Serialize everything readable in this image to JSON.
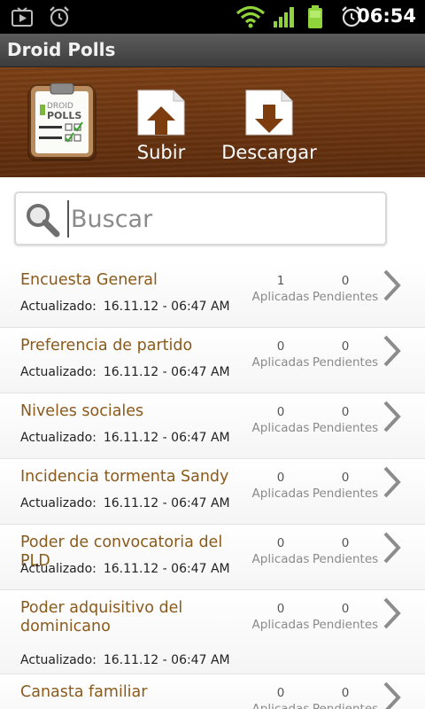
{
  "status_bar": {
    "time": "06:54",
    "icons": [
      "play-store-icon",
      "alarm-icon",
      "wifi-icon",
      "signal-icon",
      "battery-icon",
      "alarm-clock-icon"
    ]
  },
  "app_title": "Droid Polls",
  "toolbar": {
    "logo_text_top": "DROID",
    "logo_text_bottom": "POLLS",
    "upload_label": "Subir",
    "download_label": "Descargar"
  },
  "search": {
    "placeholder": "Buscar",
    "value": ""
  },
  "labels": {
    "updated": "Actualizado:",
    "applied": "Aplicadas",
    "pending": "Pendientes"
  },
  "polls": [
    {
      "name": "Encuesta General",
      "updated": "16.11.12 - 06:47 AM",
      "applied": "1",
      "pending": "0"
    },
    {
      "name": "Preferencia de partido",
      "updated": "16.11.12 - 06:47 AM",
      "applied": "0",
      "pending": "0"
    },
    {
      "name": "Niveles sociales",
      "updated": "16.11.12 - 06:47 AM",
      "applied": "0",
      "pending": "0"
    },
    {
      "name": "Incidencia tormenta Sandy",
      "updated": "16.11.12 - 06:47 AM",
      "applied": "0",
      "pending": "0"
    },
    {
      "name": "Poder de convocatoria del PLD",
      "updated": "16.11.12 - 06:47 AM",
      "applied": "0",
      "pending": "0"
    },
    {
      "name": "Poder adquisitivo del dominicano",
      "updated": "16.11.12 - 06:47 AM",
      "applied": "0",
      "pending": "0"
    },
    {
      "name": "Canasta familiar",
      "updated": "",
      "applied": "0",
      "pending": "0"
    }
  ],
  "colors": {
    "accent_wood": "#6a3410",
    "poll_name": "#8b5a1b",
    "status_green": "#8fd43a"
  }
}
